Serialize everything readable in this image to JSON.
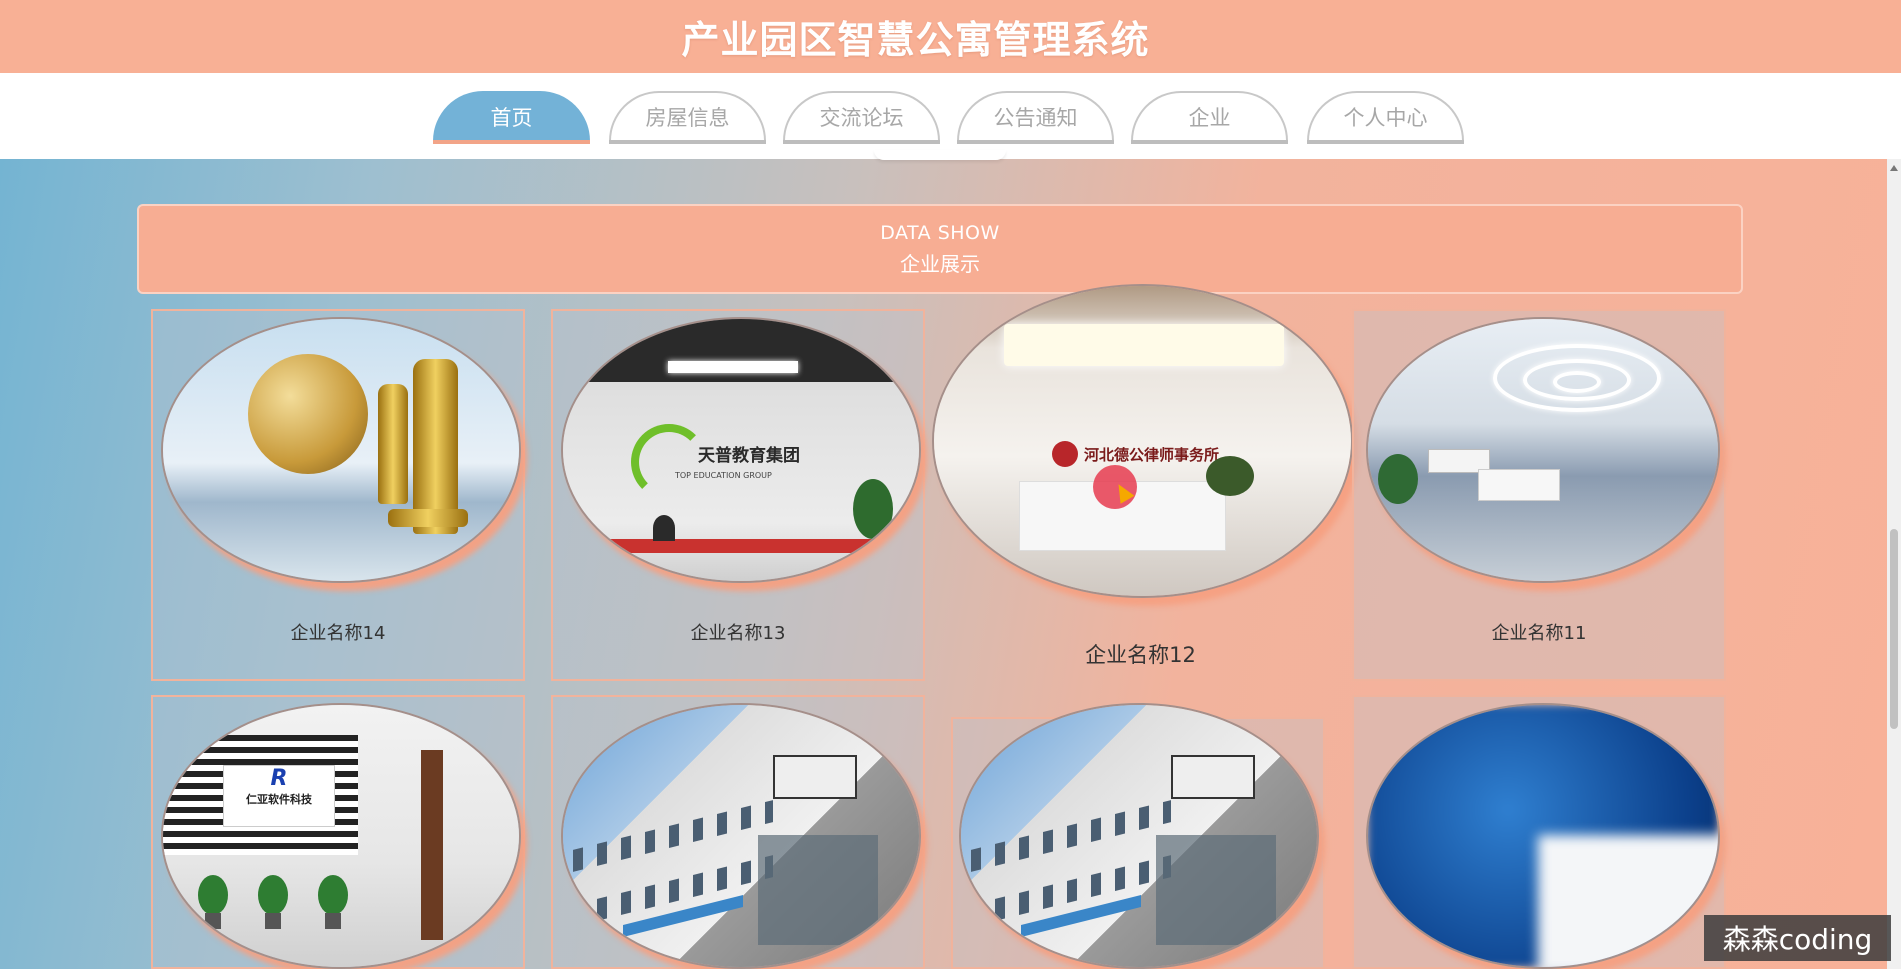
{
  "header": {
    "title": "产业园区智慧公寓管理系统"
  },
  "nav": {
    "tabs": [
      {
        "label": "首页",
        "active": true
      },
      {
        "label": "房屋信息",
        "active": false
      },
      {
        "label": "交流论坛",
        "active": false
      },
      {
        "label": "公告通知",
        "active": false
      },
      {
        "label": "企业",
        "active": false
      },
      {
        "label": "个人中心",
        "active": false
      }
    ]
  },
  "banner": {
    "en": "DATA SHOW",
    "zh": "企业展示"
  },
  "companies": [
    {
      "name": "企业名称14",
      "image": "golden-chess-globe"
    },
    {
      "name": "企业名称13",
      "image": "education-group-reception"
    },
    {
      "name": "企业名称12",
      "image": "law-firm-lobby"
    },
    {
      "name": "企业名称11",
      "image": "modern-office-lobby"
    },
    {
      "name": "",
      "image": "software-company-corridor"
    },
    {
      "name": "",
      "image": "office-building-exterior"
    },
    {
      "name": "",
      "image": "office-building-exterior"
    },
    {
      "name": "",
      "image": "blurred-blue-image"
    }
  ],
  "photo_text": {
    "education_logo": "天普教育集团",
    "education_sub": "TOP EDUCATION GROUP",
    "law_logo": "河北德公律师事务所",
    "software_logo_mark": "R",
    "software_logo": "仁亚软件科技"
  },
  "colors": {
    "header_bg": "#f8b095",
    "nav_active": "#73b2d7",
    "banner_bg": "#f7ad93",
    "card_border": "#f1b39c"
  },
  "watermark": "森森coding"
}
